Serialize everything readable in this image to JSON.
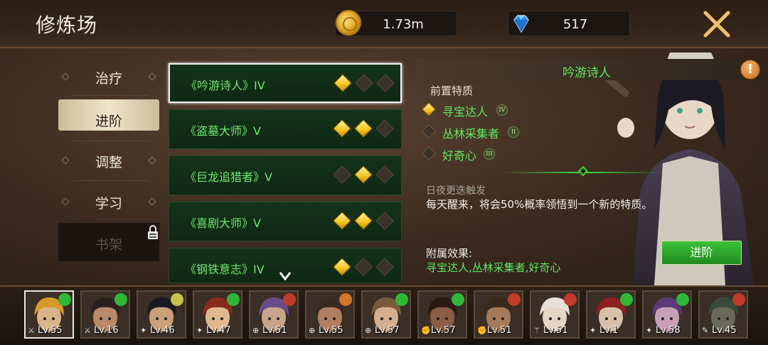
{
  "header": {
    "title": "修炼场",
    "gold": "1.73m",
    "gems": "517"
  },
  "side_menu": [
    {
      "label": "治疗",
      "state": "normal"
    },
    {
      "label": "进阶",
      "state": "active"
    },
    {
      "label": "调整",
      "state": "normal"
    },
    {
      "label": "学习",
      "state": "normal"
    },
    {
      "label": "书架",
      "state": "locked"
    }
  ],
  "traits": [
    {
      "name": "《吟游诗人》IV",
      "filled": 1,
      "selected": true
    },
    {
      "name": "《盗墓大师》V",
      "filled": 2,
      "selected": false
    },
    {
      "name": "《巨龙追猎者》V",
      "filled": 1,
      "selected": false
    },
    {
      "name": "《喜剧大师》V",
      "filled": 2,
      "selected": false
    },
    {
      "name": "《钢铁意志》IV",
      "filled": 1,
      "selected": false
    }
  ],
  "detail": {
    "name": "吟游诗人",
    "warn": "!",
    "prereq_label": "前置特质",
    "prereqs": [
      {
        "name": "寻宝达人",
        "rank": "IV",
        "met": true
      },
      {
        "name": "丛林采集者",
        "rank": "II",
        "met": false
      },
      {
        "name": "好奇心",
        "rank": "III",
        "met": false
      }
    ],
    "trigger": "日夜更迭触发",
    "description": "每天醒来，将会50%概率领悟到一个新的特质。",
    "attach_label": "附属效果:",
    "attach_value": "寻宝达人,丛林采集者,好奇心",
    "advance_label": "进阶"
  },
  "heroes": [
    {
      "level": "Lv.55",
      "mood": "g",
      "cls": "⚔",
      "selected": true
    },
    {
      "level": "Lv.16",
      "mood": "g",
      "cls": "⚔",
      "selected": false
    },
    {
      "level": "Lv.46",
      "mood": "y",
      "cls": "✦",
      "selected": false
    },
    {
      "level": "Lv.47",
      "mood": "g",
      "cls": "✦",
      "selected": false
    },
    {
      "level": "Lv.51",
      "mood": "r",
      "cls": "⊕",
      "selected": false
    },
    {
      "level": "Lv.55",
      "mood": "o",
      "cls": "⊕",
      "selected": false
    },
    {
      "level": "Lv.57",
      "mood": "g",
      "cls": "⊕",
      "selected": false
    },
    {
      "level": "Lv.57",
      "mood": "g",
      "cls": "✊",
      "selected": false
    },
    {
      "level": "Lv.51",
      "mood": "r",
      "cls": "✊",
      "selected": false
    },
    {
      "level": "Lv.51",
      "mood": "r",
      "cls": "⚚",
      "selected": false
    },
    {
      "level": "Lv.1",
      "mood": "g",
      "cls": "✦",
      "selected": false
    },
    {
      "level": "Lv.58",
      "mood": "g",
      "cls": "✦",
      "selected": false
    },
    {
      "level": "Lv.45",
      "mood": "r",
      "cls": "✎",
      "selected": false
    }
  ]
}
